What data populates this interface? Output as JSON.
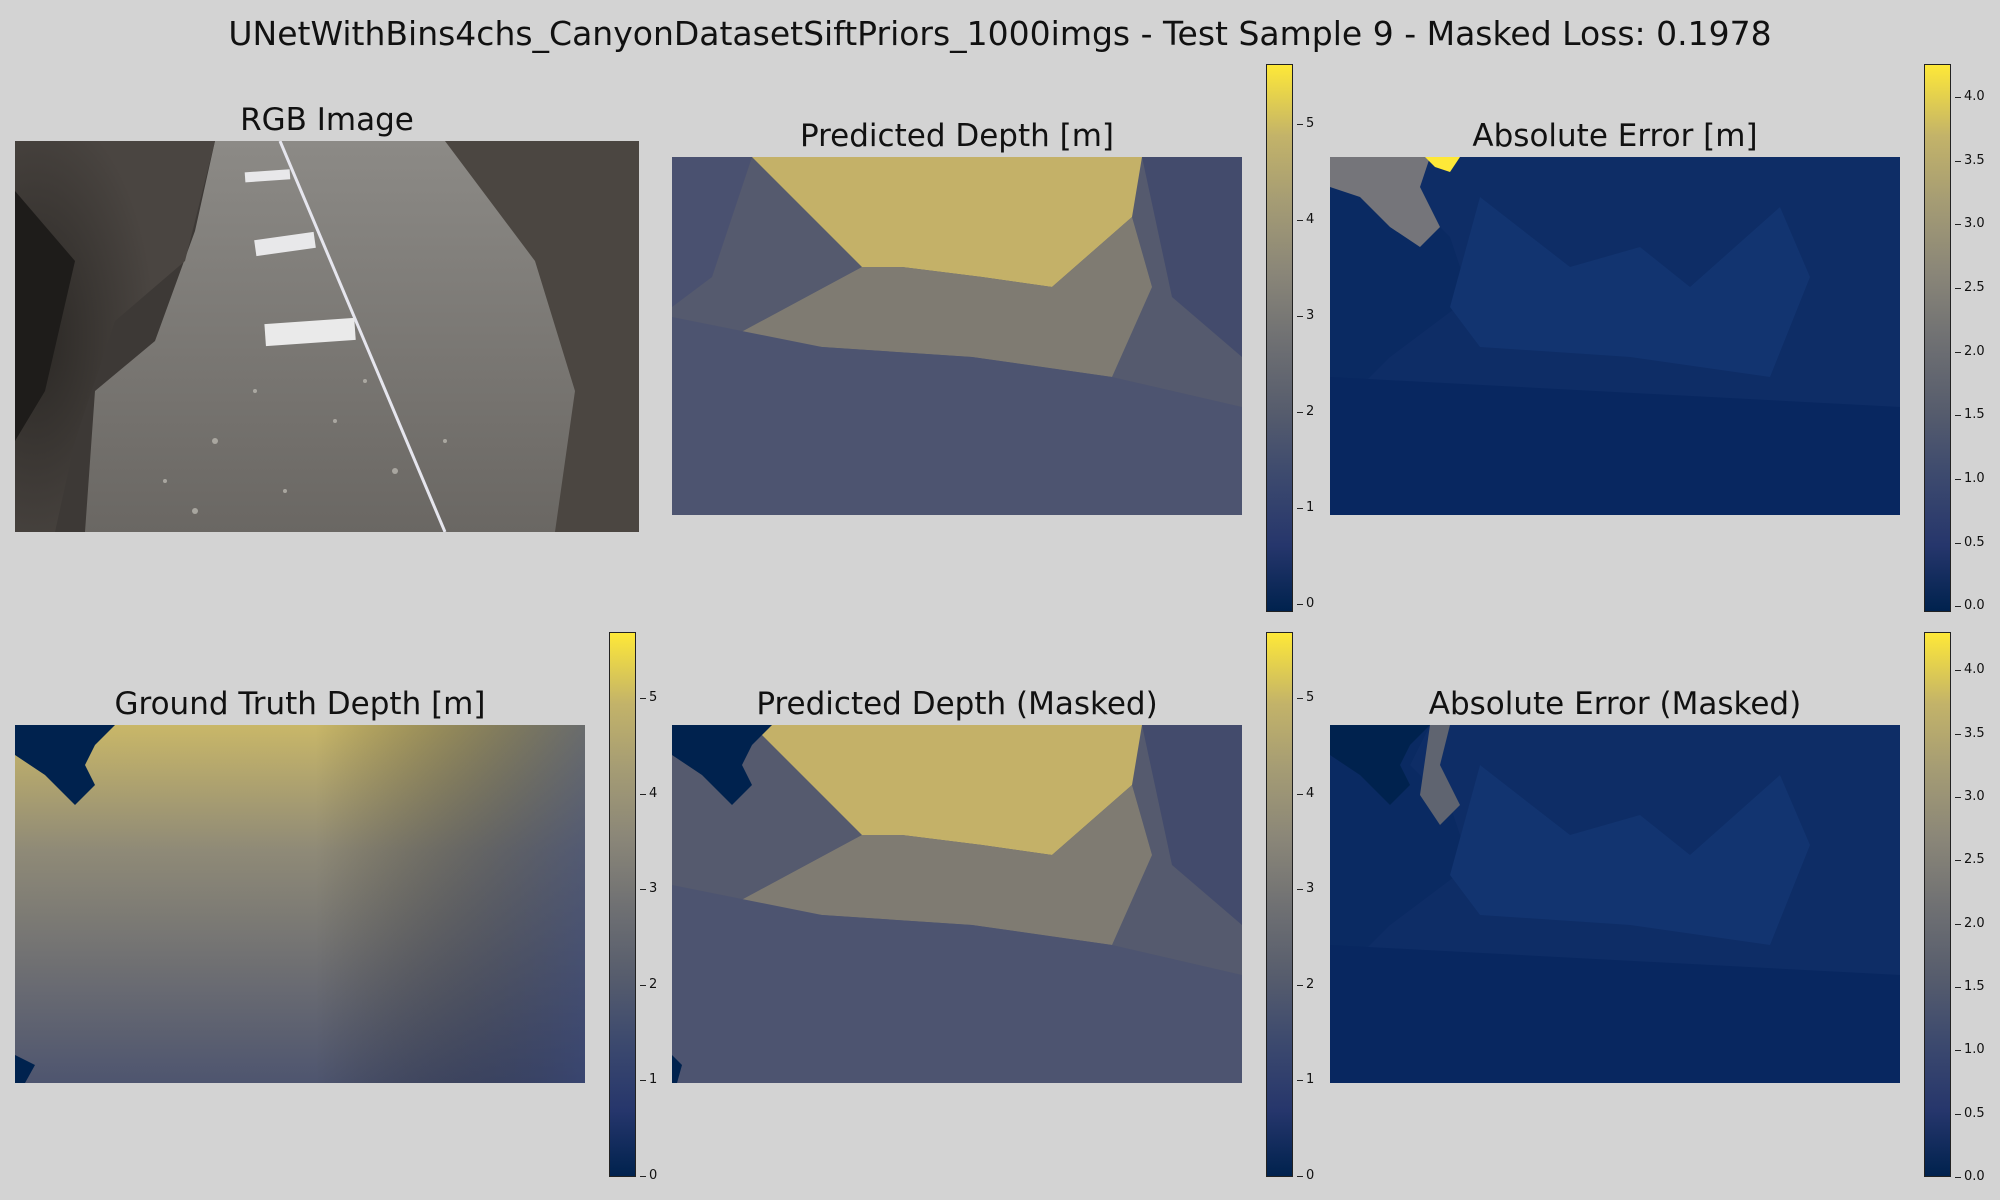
{
  "figure": {
    "title": "UNetWithBins4chs_CanyonDatasetSiftPriors_1000imgs - Test Sample 9 - Masked Loss: 0.1978"
  },
  "panels": {
    "rgb": {
      "title": "RGB Image"
    },
    "pred": {
      "title": "Predicted Depth [m]"
    },
    "abs_err": {
      "title": "Absolute Error [m]"
    },
    "gt": {
      "title": "Ground Truth Depth [m]"
    },
    "pred_masked": {
      "title": "Predicted Depth (Masked)"
    },
    "abs_err_masked": {
      "title": "Absolute Error (Masked)"
    }
  },
  "colorbars": {
    "depth": {
      "colormap": "cividis",
      "min": 0,
      "max": 5.7,
      "ticks": [
        {
          "v": 0,
          "label": "0"
        },
        {
          "v": 1,
          "label": "1"
        },
        {
          "v": 2,
          "label": "2"
        },
        {
          "v": 3,
          "label": "3"
        },
        {
          "v": 4,
          "label": "4"
        },
        {
          "v": 5,
          "label": "5"
        }
      ]
    },
    "error": {
      "colormap": "cividis",
      "min": 0,
      "max": 4.3,
      "ticks": [
        {
          "v": 0,
          "label": "0.0"
        },
        {
          "v": 0.5,
          "label": "0.5"
        },
        {
          "v": 1,
          "label": "1.0"
        },
        {
          "v": 1.5,
          "label": "1.5"
        },
        {
          "v": 2,
          "label": "2.0"
        },
        {
          "v": 2.5,
          "label": "2.5"
        },
        {
          "v": 3,
          "label": "3.0"
        },
        {
          "v": 3.5,
          "label": "3.5"
        },
        {
          "v": 4,
          "label": "4.0"
        }
      ]
    }
  },
  "colors": {
    "background": "#d3d3d3",
    "cividis_low": "#00224e",
    "cividis_high": "#fee838"
  }
}
